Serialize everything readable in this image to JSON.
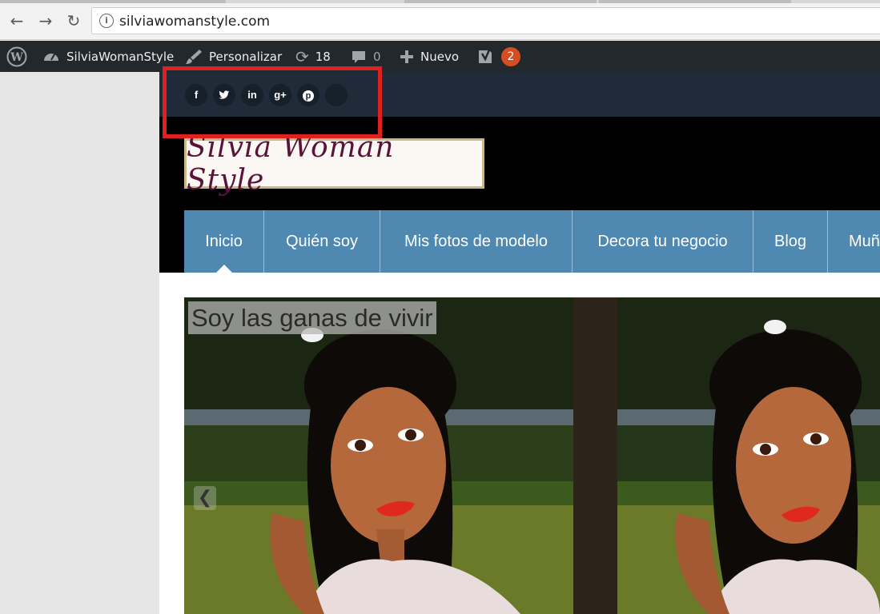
{
  "browser": {
    "back_icon": "←",
    "forward_icon": "→",
    "reload_icon": "↻",
    "info_icon": "i",
    "url": "silviawomanstyle.com"
  },
  "admin_bar": {
    "site_name": "SilviaWomanStyle",
    "customize": "Personalizar",
    "updates_count": "18",
    "comments_count": "0",
    "new": "Nuevo",
    "seo_notifications": "2",
    "badge_color": "#d54e21"
  },
  "social": {
    "facebook": "f",
    "twitter": "t",
    "linkedin": "in",
    "googleplus": "g+",
    "pinterest": "p"
  },
  "logo": {
    "text": "Silvia Woman Style"
  },
  "menu": {
    "items": [
      {
        "label": "Inicio"
      },
      {
        "label": "Quién soy"
      },
      {
        "label": "Mis fotos de modelo"
      },
      {
        "label": "Decora tu negocio"
      },
      {
        "label": "Blog"
      },
      {
        "label": "Muñ"
      }
    ],
    "color": "#4f88b0"
  },
  "slider": {
    "caption": "Soy las ganas de vivir",
    "prev_icon": "❮"
  }
}
